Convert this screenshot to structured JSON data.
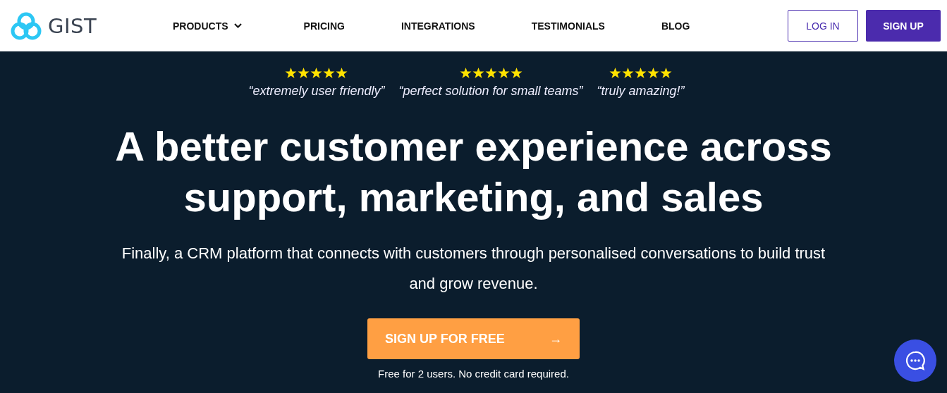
{
  "header": {
    "logo": "GIST",
    "nav": [
      {
        "label": "PRODUCTS",
        "dropdown": true
      },
      {
        "label": "PRICING",
        "dropdown": false
      },
      {
        "label": "INTEGRATIONS",
        "dropdown": false
      },
      {
        "label": "TESTIMONIALS",
        "dropdown": false
      },
      {
        "label": "BLOG",
        "dropdown": false
      }
    ],
    "login": "LOG IN",
    "signup": "SIGN UP"
  },
  "reviews": [
    {
      "stars": 5,
      "quote": "“extremely user friendly”"
    },
    {
      "stars": 5,
      "quote": "“perfect solution for small teams”"
    },
    {
      "stars": 5,
      "quote": "“truly amazing!”"
    }
  ],
  "hero": {
    "heading": "A better customer experience across support, marketing, and sales",
    "subtitle": "Finally, a CRM platform that connects with customers through personalised conversations to build trust and grow revenue.",
    "cta": {
      "label": "SIGN UP FOR FREE",
      "arrow": "→"
    },
    "note": "Free for 2 users. No credit card required."
  }
}
